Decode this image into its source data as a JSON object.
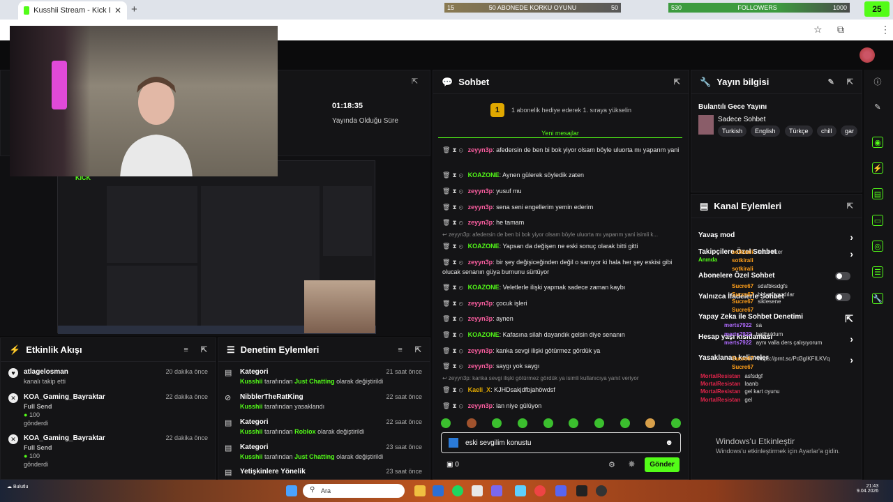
{
  "browser": {
    "tab_title": "Kusshii Stream - Kick Dashboard",
    "close": "✕",
    "new_tab": "+",
    "bar1": {
      "left": "15",
      "label": "50 ABONEDE KORKU OYUNU",
      "right": "50",
      "progress": 0.0
    },
    "bar2": {
      "left": "530",
      "label": "FOLLOWERS",
      "right": "1000",
      "progress": 0.53
    },
    "logo_num": "25"
  },
  "stats": {
    "time_value": "01:18:35",
    "time_label": "Yayında Olduğu Süre"
  },
  "preview": {
    "kick_text": "KICK"
  },
  "activity": {
    "title": "Etkinlik Akışı",
    "items": [
      {
        "name": "atlagelosman",
        "time": "20 dakika önce",
        "sub": "kanalı takip etti"
      },
      {
        "name": "KOA_Gaming_Bayraktar",
        "time": "22 dakika önce",
        "line1": "Full Send",
        "amount": "100",
        "sub": "gönderdi"
      },
      {
        "name": "KOA_Gaming_Bayraktar",
        "time": "22 dakika önce",
        "line1": "Full Send",
        "amount": "100",
        "sub": "gönderdi"
      }
    ]
  },
  "moderation": {
    "title": "Denetim Eylemleri",
    "items": [
      {
        "title": "Kategori",
        "time": "21 saat önce",
        "actor": "Kusshii",
        "mid": "tarafından",
        "target": "Just Chatting",
        "tail": "olarak değiştirildi"
      },
      {
        "title": "NibblerTheRatKing",
        "time": "22 saat önce",
        "actor": "Kusshii",
        "mid": "tarafından yasaklandı",
        "target": "",
        "tail": ""
      },
      {
        "title": "Kategori",
        "time": "22 saat önce",
        "actor": "Kusshii",
        "mid": "tarafından",
        "target": "Roblox",
        "tail": "olarak değiştirildi"
      },
      {
        "title": "Kategori",
        "time": "23 saat önce",
        "actor": "Kusshii",
        "mid": "tarafından",
        "target": "Just Chatting",
        "tail": "olarak değiştirildi"
      },
      {
        "title": "Yetişkinlere Yönelik",
        "time": "23 saat önce",
        "actor": "",
        "mid": "",
        "target": "",
        "tail": ""
      }
    ]
  },
  "chat": {
    "title": "Sohbet",
    "pinned_badge": "1",
    "pinned_text": "1 abonelik hediye ederek 1. sıraya yükselin",
    "new_messages": "Yeni mesajlar",
    "messages": [
      {
        "user": "zeyyn3p",
        "color": "#ff5fa2",
        "text": "afedersin de ben bi bok yiyor olsam böyle uluorta mı yaparım yani",
        "two": true
      },
      {
        "user": "KOAZONE",
        "color": "#53fc18",
        "text": "Aynen gülerek söyledik zaten"
      },
      {
        "user": "zeyyn3p",
        "color": "#ff5fa2",
        "text": "yusuf mu"
      },
      {
        "user": "zeyyn3p",
        "color": "#ff5fa2",
        "text": "sena seni engellerim yemin ederim"
      },
      {
        "user": "zeyyn3p",
        "color": "#ff5fa2",
        "text": "he tamam"
      },
      {
        "user": "KOAZONE",
        "color": "#53fc18",
        "text": "Yapsan da değişen ne eski sonuç olarak bitti gitti",
        "reply": "zeyyn3p: afedersin de ben bi bok yiyor olsam böyle uluorta mı yaparım yani isimli k..."
      },
      {
        "user": "zeyyn3p",
        "color": "#ff5fa2",
        "text": "bir şey değişiceğinden değil o sanıyor ki hala her şey eskisi gibi olucak senanın güya burnunu sürtüyor",
        "two": true
      },
      {
        "user": "KOAZONE",
        "color": "#53fc18",
        "text": "Veletlerle ilişki yapmak sadece zaman kaybı"
      },
      {
        "user": "zeyyn3p",
        "color": "#ff5fa2",
        "text": "çocuk işleri"
      },
      {
        "user": "zeyyn3p",
        "color": "#ff5fa2",
        "text": "aynen"
      },
      {
        "user": "KOAZONE",
        "color": "#53fc18",
        "text": "Kafasına silah dayandık gelsin diye senanın"
      },
      {
        "user": "zeyyn3p",
        "color": "#ff5fa2",
        "text": "kanka sevgi ilişki götürmez gördük ya"
      },
      {
        "user": "zeyyn3p",
        "color": "#ff5fa2",
        "text": "saygı yok saygı"
      },
      {
        "user": "Kaeli_X",
        "color": "#e0a800",
        "text": "KJHDsakjdfbjahöwdsf",
        "reply": "zeyyn3p: kanka sevgi ilişki götürmez gördük ya isimli kullanıcıya yanıt veriyor"
      },
      {
        "user": "zeyyn3p",
        "color": "#ff5fa2",
        "text": "lan niye gülüyon"
      }
    ],
    "input_value": "eski sevgilim konustu",
    "send_label": "Gönder",
    "count": "0"
  },
  "info": {
    "title": "Yayın bilgisi",
    "stream_title": "Bulantılı Gece Yayını",
    "category": "Sadece Sohbet",
    "tags": [
      "Turkish",
      "English",
      "Türkçe",
      "chill",
      "gar"
    ]
  },
  "actions": {
    "title": "Kanal Eylemleri",
    "rows": [
      {
        "label": "Yavaş mod",
        "kind": "chev"
      },
      {
        "label": "Takipçilere Özel Sohbet",
        "kind": "chev"
      },
      {
        "label": "Abonelere Özel Sohbet",
        "kind": "toggle"
      },
      {
        "label": "Yalnızca İfadelerle Sohbet",
        "kind": "toggle"
      },
      {
        "label": "Yapay Zeka ile Sohbet Denetimi",
        "kind": "ext"
      },
      {
        "label": "Hesap yaşı kısıtlaması",
        "kind": "chev"
      },
      {
        "label": "Yasaklanan kelimeler",
        "kind": "chev"
      }
    ],
    "overlay": [
      {
        "u": "sotkirali",
        "t": "kaldı siker",
        "c": "#ff9f1a"
      },
      {
        "u": "Anında",
        "t": "",
        "c": "#53fc18"
      },
      {
        "u": "sotkirali",
        "t": "",
        "c": "#ff9f1a"
      },
      {
        "u": "sotkirali",
        "t": "",
        "c": "#ff9f1a"
      },
      {
        "u": "Sucre67",
        "t": "sdafbksdgfs",
        "c": "#ff9f1a"
      },
      {
        "u": "Sucre67",
        "t": "bi harf yazdılar",
        "c": "#ff9f1a"
      },
      {
        "u": "Sucre67",
        "t": "siklesene",
        "c": "#ff9f1a"
      },
      {
        "u": "Sucre67",
        "t": "",
        "c": "#ff9f1a"
      },
      {
        "u": "merts7922",
        "t": "sa",
        "c": "#b06bff"
      },
      {
        "u": "merts7922",
        "t": "hejibuldum",
        "c": "#b06bff"
      },
      {
        "u": "merts7922",
        "t": "aynı valla ders çalışıyorum",
        "c": "#b06bff"
      },
      {
        "u": "Sucre67",
        "t": "https://prnt.sc/Pd3gIKFILKVq",
        "c": "#ff9f1a"
      },
      {
        "u": "Sucre67",
        "t": "",
        "c": "#ff9f1a"
      },
      {
        "u": "MortalResistan",
        "t": "asfsdgf",
        "c": "#e0244a"
      },
      {
        "u": "MortalResistan",
        "t": "laanb",
        "c": "#e0244a"
      },
      {
        "u": "MortalResistan",
        "t": "gel kart oyunu",
        "c": "#e0244a"
      },
      {
        "u": "MortalResistan",
        "t": "gel",
        "c": "#e0244a"
      }
    ],
    "windows_1": "Windows'u Etkinleştir",
    "windows_2": "Windows'u etkinleştirmek için Ayarlar'a gidin."
  },
  "taskbar": {
    "search": "Ara",
    "time": "21:43",
    "date": "9.04.2026",
    "weather": "Bulutlu"
  }
}
